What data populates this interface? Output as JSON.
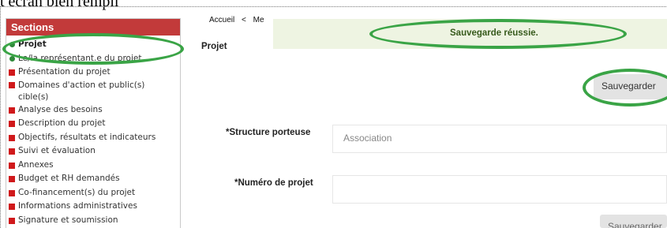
{
  "caption": "t écran bien rempli",
  "sidebar": {
    "title": "Sections",
    "items": [
      {
        "label": "Projet",
        "marker": "green-dot",
        "active": true
      },
      {
        "label": "Le/la représentant.e du projet",
        "marker": "green-dot",
        "active": false
      },
      {
        "label": "Présentation du projet",
        "marker": "red-square",
        "active": false
      },
      {
        "label": "Domaines d'action et public(s) cible(s)",
        "marker": "red-square",
        "active": false
      },
      {
        "label": "Analyse des besoins",
        "marker": "red-square",
        "active": false
      },
      {
        "label": "Description du projet",
        "marker": "red-square",
        "active": false
      },
      {
        "label": "Objectifs, résultats et indicateurs",
        "marker": "red-square",
        "active": false
      },
      {
        "label": "Suivi et évaluation",
        "marker": "red-square",
        "active": false
      },
      {
        "label": "Annexes",
        "marker": "red-square",
        "active": false
      },
      {
        "label": "Budget et RH demandés",
        "marker": "red-square",
        "active": false
      },
      {
        "label": "Co-financement(s) du projet",
        "marker": "red-square",
        "active": false
      },
      {
        "label": "Informations administratives",
        "marker": "red-square",
        "active": false
      },
      {
        "label": "Signature et soumission",
        "marker": "red-square",
        "active": false
      }
    ]
  },
  "breadcrumb": {
    "home": "Accueil",
    "separator": "<",
    "current": "Me"
  },
  "toast": {
    "message": "Sauvegarde réussie."
  },
  "page": {
    "title": "Projet"
  },
  "buttons": {
    "save_top": "Sauvegarder",
    "save_bottom": "Sauvegarder"
  },
  "form": {
    "structure": {
      "label": "*Structure porteuse",
      "placeholder": "Association"
    },
    "numero": {
      "label": "*Numéro de projet",
      "value": ""
    }
  },
  "colors": {
    "sidebar_header": "#c23a3a",
    "toast_bg": "#eef4e2",
    "toast_text": "#375a1c",
    "annotation": "#3aa446",
    "bullet_red": "#d0191b",
    "bullet_green": "#2f8a3a"
  }
}
